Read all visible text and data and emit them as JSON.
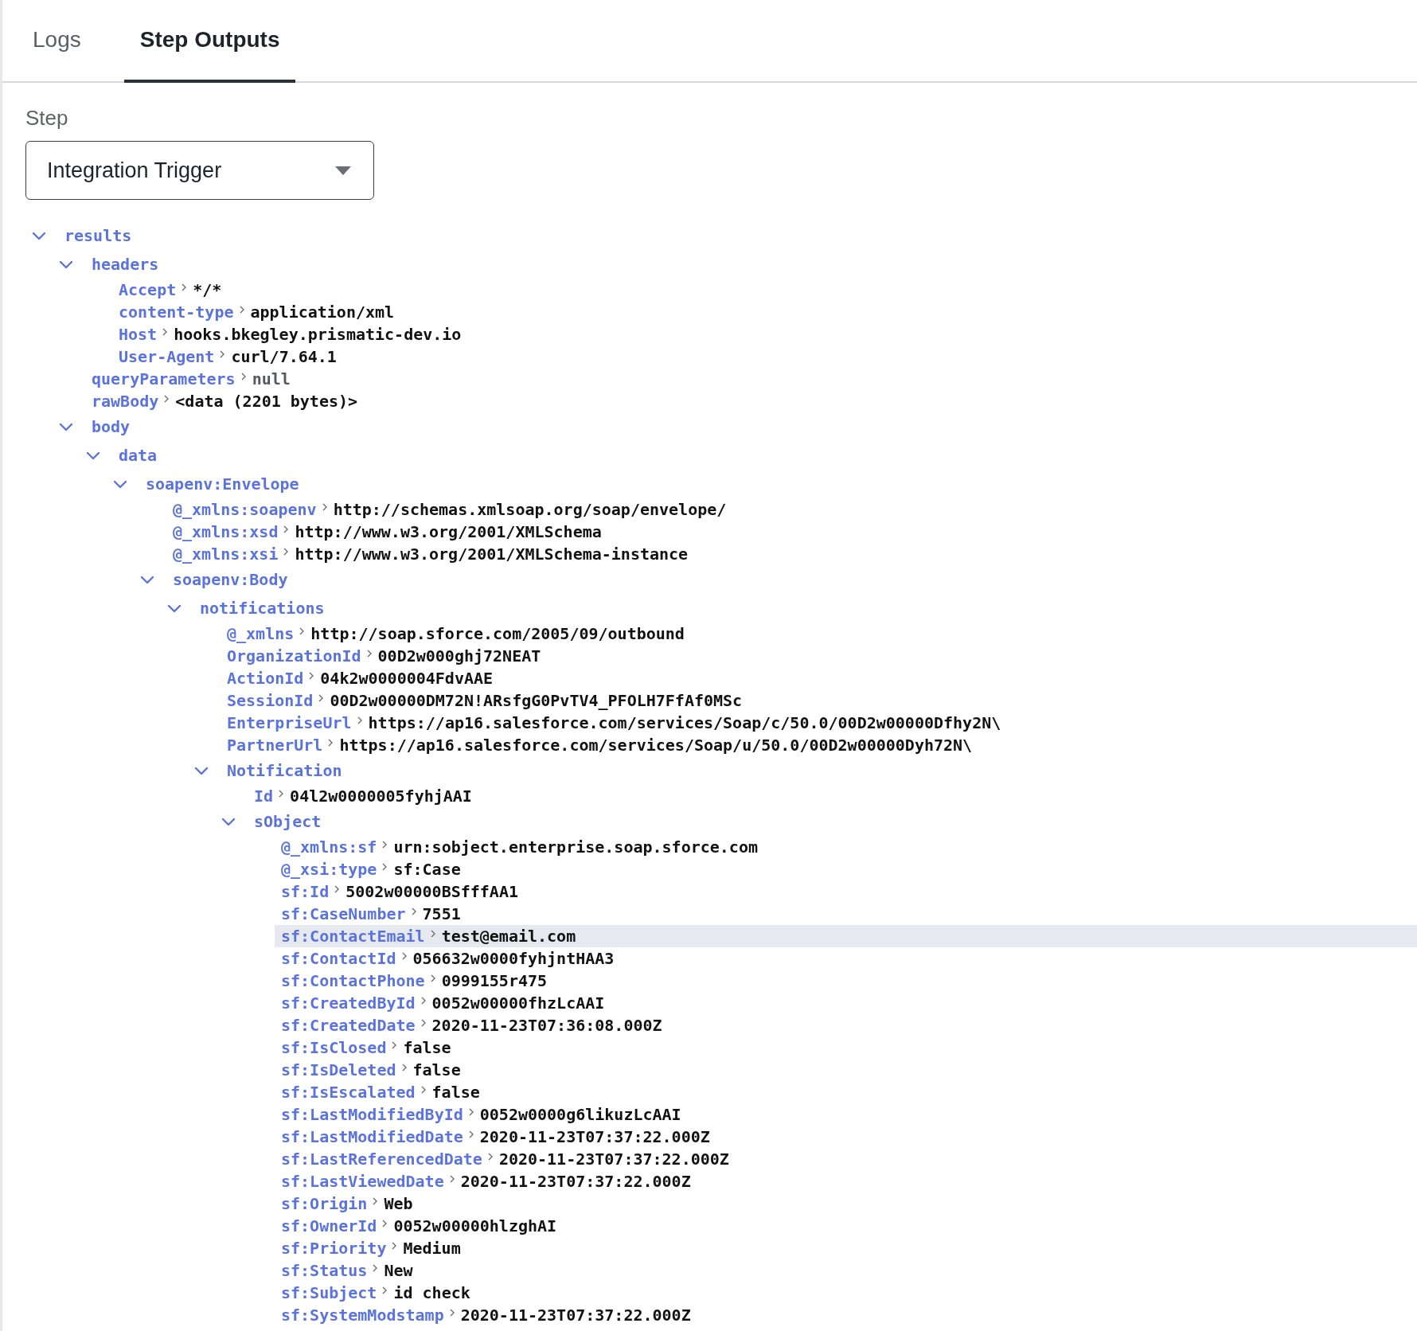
{
  "tabs": [
    {
      "label": "Logs",
      "selected": false
    },
    {
      "label": "Step Outputs",
      "selected": true
    }
  ],
  "step": {
    "label": "Step",
    "value": "Integration Trigger"
  },
  "tree": [
    {
      "kind": "branch",
      "key": "results",
      "expanded": true,
      "selected": false,
      "children": [
        {
          "kind": "branch",
          "key": "headers",
          "expanded": true,
          "selected": false,
          "children": [
            {
              "kind": "leaf",
              "key": "Accept",
              "value": "*/*",
              "is_null": false,
              "selected": false
            },
            {
              "kind": "leaf",
              "key": "content-type",
              "value": "application/xml",
              "is_null": false,
              "selected": false
            },
            {
              "kind": "leaf",
              "key": "Host",
              "value": "hooks.bkegley.prismatic-dev.io",
              "is_null": false,
              "selected": false
            },
            {
              "kind": "leaf",
              "key": "User-Agent",
              "value": "curl/7.64.1",
              "is_null": false,
              "selected": false
            }
          ]
        },
        {
          "kind": "leaf",
          "key": "queryParameters",
          "value": "null",
          "is_null": true,
          "selected": false
        },
        {
          "kind": "leaf",
          "key": "rawBody",
          "value": "<data (2201 bytes)>",
          "is_null": false,
          "selected": false
        },
        {
          "kind": "branch",
          "key": "body",
          "expanded": true,
          "selected": false,
          "children": [
            {
              "kind": "branch",
              "key": "data",
              "expanded": true,
              "selected": false,
              "children": [
                {
                  "kind": "branch",
                  "key": "soapenv:Envelope",
                  "expanded": true,
                  "selected": false,
                  "children": [
                    {
                      "kind": "leaf",
                      "key": "@_xmlns:soapenv",
                      "value": "http://schemas.xmlsoap.org/soap/envelope/",
                      "is_null": false,
                      "selected": false
                    },
                    {
                      "kind": "leaf",
                      "key": "@_xmlns:xsd",
                      "value": "http://www.w3.org/2001/XMLSchema",
                      "is_null": false,
                      "selected": false
                    },
                    {
                      "kind": "leaf",
                      "key": "@_xmlns:xsi",
                      "value": "http://www.w3.org/2001/XMLSchema-instance",
                      "is_null": false,
                      "selected": false
                    },
                    {
                      "kind": "branch",
                      "key": "soapenv:Body",
                      "expanded": true,
                      "selected": false,
                      "children": [
                        {
                          "kind": "branch",
                          "key": "notifications",
                          "expanded": true,
                          "selected": false,
                          "children": [
                            {
                              "kind": "leaf",
                              "key": "@_xmlns",
                              "value": "http://soap.sforce.com/2005/09/outbound",
                              "is_null": false,
                              "selected": false
                            },
                            {
                              "kind": "leaf",
                              "key": "OrganizationId",
                              "value": "00D2w000ghj72NEAT",
                              "is_null": false,
                              "selected": false
                            },
                            {
                              "kind": "leaf",
                              "key": "ActionId",
                              "value": "04k2w0000004FdvAAE",
                              "is_null": false,
                              "selected": false
                            },
                            {
                              "kind": "leaf",
                              "key": "SessionId",
                              "value": "00D2w00000DM72N!ARsfgG0PvTV4_PFOLH7FfAf0MSc",
                              "is_null": false,
                              "selected": false
                            },
                            {
                              "kind": "leaf",
                              "key": "EnterpriseUrl",
                              "value": "https://ap16.salesforce.com/services/Soap/c/50.0/00D2w00000Dfhy2N\\",
                              "is_null": false,
                              "selected": false
                            },
                            {
                              "kind": "leaf",
                              "key": "PartnerUrl",
                              "value": "https://ap16.salesforce.com/services/Soap/u/50.0/00D2w00000Dyh72N\\",
                              "is_null": false,
                              "selected": false
                            },
                            {
                              "kind": "branch",
                              "key": "Notification",
                              "expanded": true,
                              "selected": false,
                              "children": [
                                {
                                  "kind": "leaf",
                                  "key": "Id",
                                  "value": "04l2w0000005fyhjAAI",
                                  "is_null": false,
                                  "selected": false
                                },
                                {
                                  "kind": "branch",
                                  "key": "sObject",
                                  "expanded": true,
                                  "selected": false,
                                  "children": [
                                    {
                                      "kind": "leaf",
                                      "key": "@_xmlns:sf",
                                      "value": "urn:sobject.enterprise.soap.sforce.com",
                                      "is_null": false,
                                      "selected": false
                                    },
                                    {
                                      "kind": "leaf",
                                      "key": "@_xsi:type",
                                      "value": "sf:Case",
                                      "is_null": false,
                                      "selected": false
                                    },
                                    {
                                      "kind": "leaf",
                                      "key": "sf:Id",
                                      "value": "5002w00000BSfffAA1",
                                      "is_null": false,
                                      "selected": false
                                    },
                                    {
                                      "kind": "leaf",
                                      "key": "sf:CaseNumber",
                                      "value": "7551",
                                      "is_null": false,
                                      "selected": false
                                    },
                                    {
                                      "kind": "leaf",
                                      "key": "sf:ContactEmail",
                                      "value": "test@email.com",
                                      "is_null": false,
                                      "selected": true
                                    },
                                    {
                                      "kind": "leaf",
                                      "key": "sf:ContactId",
                                      "value": "056632w0000fyhjntHAA3",
                                      "is_null": false,
                                      "selected": false
                                    },
                                    {
                                      "kind": "leaf",
                                      "key": "sf:ContactPhone",
                                      "value": "0999155r475",
                                      "is_null": false,
                                      "selected": false
                                    },
                                    {
                                      "kind": "leaf",
                                      "key": "sf:CreatedById",
                                      "value": "0052w00000fhzLcAAI",
                                      "is_null": false,
                                      "selected": false
                                    },
                                    {
                                      "kind": "leaf",
                                      "key": "sf:CreatedDate",
                                      "value": "2020-11-23T07:36:08.000Z",
                                      "is_null": false,
                                      "selected": false
                                    },
                                    {
                                      "kind": "leaf",
                                      "key": "sf:IsClosed",
                                      "value": "false",
                                      "is_null": false,
                                      "selected": false
                                    },
                                    {
                                      "kind": "leaf",
                                      "key": "sf:IsDeleted",
                                      "value": "false",
                                      "is_null": false,
                                      "selected": false
                                    },
                                    {
                                      "kind": "leaf",
                                      "key": "sf:IsEscalated",
                                      "value": "false",
                                      "is_null": false,
                                      "selected": false
                                    },
                                    {
                                      "kind": "leaf",
                                      "key": "sf:LastModifiedById",
                                      "value": "0052w0000g6likuzLcAAI",
                                      "is_null": false,
                                      "selected": false
                                    },
                                    {
                                      "kind": "leaf",
                                      "key": "sf:LastModifiedDate",
                                      "value": "2020-11-23T07:37:22.000Z",
                                      "is_null": false,
                                      "selected": false
                                    },
                                    {
                                      "kind": "leaf",
                                      "key": "sf:LastReferencedDate",
                                      "value": "2020-11-23T07:37:22.000Z",
                                      "is_null": false,
                                      "selected": false
                                    },
                                    {
                                      "kind": "leaf",
                                      "key": "sf:LastViewedDate",
                                      "value": "2020-11-23T07:37:22.000Z",
                                      "is_null": false,
                                      "selected": false
                                    },
                                    {
                                      "kind": "leaf",
                                      "key": "sf:Origin",
                                      "value": "Web",
                                      "is_null": false,
                                      "selected": false
                                    },
                                    {
                                      "kind": "leaf",
                                      "key": "sf:OwnerId",
                                      "value": "0052w00000hlzghAI",
                                      "is_null": false,
                                      "selected": false
                                    },
                                    {
                                      "kind": "leaf",
                                      "key": "sf:Priority",
                                      "value": "Medium",
                                      "is_null": false,
                                      "selected": false
                                    },
                                    {
                                      "kind": "leaf",
                                      "key": "sf:Status",
                                      "value": "New",
                                      "is_null": false,
                                      "selected": false
                                    },
                                    {
                                      "kind": "leaf",
                                      "key": "sf:Subject",
                                      "value": "id check",
                                      "is_null": false,
                                      "selected": false
                                    },
                                    {
                                      "kind": "leaf",
                                      "key": "sf:SystemModstamp",
                                      "value": "2020-11-23T07:37:22.000Z",
                                      "is_null": false,
                                      "selected": false
                                    }
                                  ]
                                }
                              ]
                            }
                          ]
                        }
                      ]
                    }
                  ]
                }
              ]
            }
          ]
        }
      ]
    }
  ]
}
